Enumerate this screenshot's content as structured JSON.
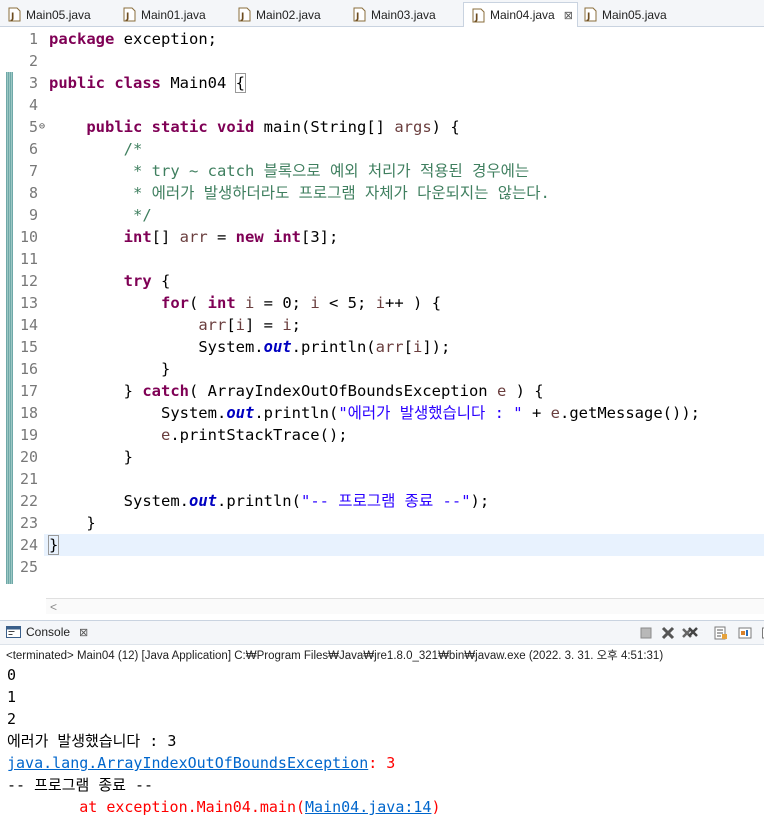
{
  "editor_tabs": [
    {
      "label": "Main05.java",
      "active": false
    },
    {
      "label": "Main01.java",
      "active": false
    },
    {
      "label": "Main02.java",
      "active": false
    },
    {
      "label": "Main03.java",
      "active": false
    },
    {
      "label": "Main04.java",
      "active": true,
      "close": "⊠"
    },
    {
      "label": "Main05.java",
      "active": false
    }
  ],
  "line_numbers": [
    "1",
    "2",
    "3",
    "4",
    "5",
    "6",
    "7",
    "8",
    "9",
    "10",
    "11",
    "12",
    "13",
    "14",
    "15",
    "16",
    "17",
    "18",
    "19",
    "20",
    "21",
    "22",
    "23",
    "24",
    "25"
  ],
  "fold_marker": "⊖",
  "code": {
    "l1_kw": "package",
    "l1_rest": " exception;",
    "l3_kw1": "public",
    "l3_kw2": "class",
    "l3_name": " Main04 ",
    "l3_brace": "{",
    "l5_kw1": "public",
    "l5_kw2": "static",
    "l5_kw3": "void",
    "l5_sig": " main(String[] ",
    "l5_arg": "args",
    "l5_end": ") {",
    "l6": "/*",
    "l7": " * try ~ catch 블록으로 예외 처리가 적용된 경우에는",
    "l8": " * 에러가 발생하더라도 프로그램 자체가 다운되지는 않는다.",
    "l9": " */",
    "l10_kw1": "int",
    "l10_a": "[] ",
    "l10_var": "arr",
    "l10_b": " = ",
    "l10_kw2": "new",
    "l10_kw3": "int",
    "l10_c": "[3];",
    "l12_kw": "try",
    "l12_rest": " {",
    "l13_kw1": "for",
    "l13_a": "( ",
    "l13_kw2": "int",
    "l13_b": " ",
    "l13_v1": "i",
    "l13_c": " = 0; ",
    "l13_v2": "i",
    "l13_d": " < 5; ",
    "l13_v3": "i",
    "l13_e": "++ ) {",
    "l14_v1": "arr",
    "l14_a": "[",
    "l14_v2": "i",
    "l14_b": "] = ",
    "l14_v3": "i",
    "l14_c": ";",
    "l15_a": "System.",
    "l15_out": "out",
    "l15_b": ".println(",
    "l15_v1": "arr",
    "l15_c": "[",
    "l15_v2": "i",
    "l15_d": "]);",
    "l16": "}",
    "l17_a": "} ",
    "l17_kw": "catch",
    "l17_b": "( ArrayIndexOutOfBoundsException ",
    "l17_v": "e",
    "l17_c": " ) {",
    "l18_a": "System.",
    "l18_out": "out",
    "l18_b": ".println(",
    "l18_str": "\"에러가 발생했습니다 : \"",
    "l18_c": " + ",
    "l18_v": "e",
    "l18_d": ".getMessage());",
    "l19_v": "e",
    "l19_a": ".printStackTrace();",
    "l20": "}",
    "l22_a": "System.",
    "l22_out": "out",
    "l22_b": ".println(",
    "l22_str": "\"-- 프로그램 종료 --\"",
    "l22_c": ");",
    "l23": "}",
    "l24": "}"
  },
  "console": {
    "tab_label": "Console",
    "tab_close": "⊠",
    "terminated": "<terminated> Main04 (12) [Java Application] C:₩Program Files₩Java₩jre1.8.0_321₩bin₩javaw.exe (2022. 3. 31. 오후 4:51:31)",
    "out": [
      "0",
      "1",
      "2",
      "에러가 발생했습니다 : 3"
    ],
    "exception_class": "java.lang.ArrayIndexOutOfBoundsException",
    "exception_msg": ": 3",
    "end_line": "-- 프로그램 종료 --",
    "stack_prefix": "        at exception.Main04.main(",
    "stack_link": "Main04.java:14",
    "stack_suffix": ")"
  },
  "colors": {
    "keyword": "#7f0055",
    "comment": "#3f7f5f",
    "string": "#2a00ff",
    "field": "#0000c0",
    "error": "#ff0000",
    "link": "#0066cc"
  }
}
